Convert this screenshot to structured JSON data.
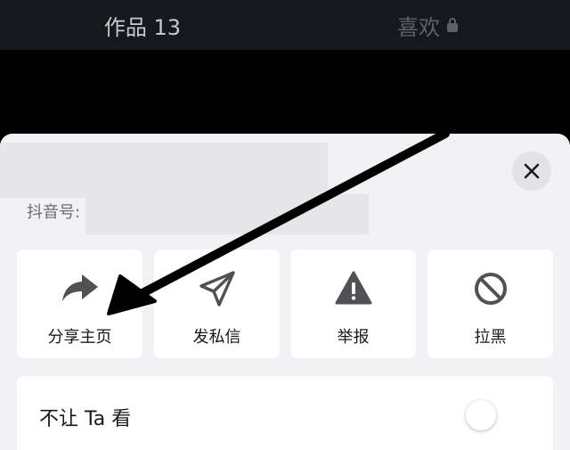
{
  "tabs": {
    "works_label": "作品 13",
    "likes_label": "喜欢"
  },
  "sheet": {
    "id_label": "抖音号:",
    "actions": [
      {
        "label": "分享主页",
        "icon": "share-icon"
      },
      {
        "label": "发私信",
        "icon": "send-icon"
      },
      {
        "label": "举报",
        "icon": "warning-icon"
      },
      {
        "label": "拉黑",
        "icon": "block-icon"
      }
    ],
    "toggle": {
      "label": "不让 Ta 看",
      "on": false
    }
  },
  "colors": {
    "tab_bar": "#16171f",
    "sheet_bg": "#f2f2f5",
    "card_bg": "#ffffff",
    "icon": "#505055",
    "annotation_arrow": "#000000"
  }
}
